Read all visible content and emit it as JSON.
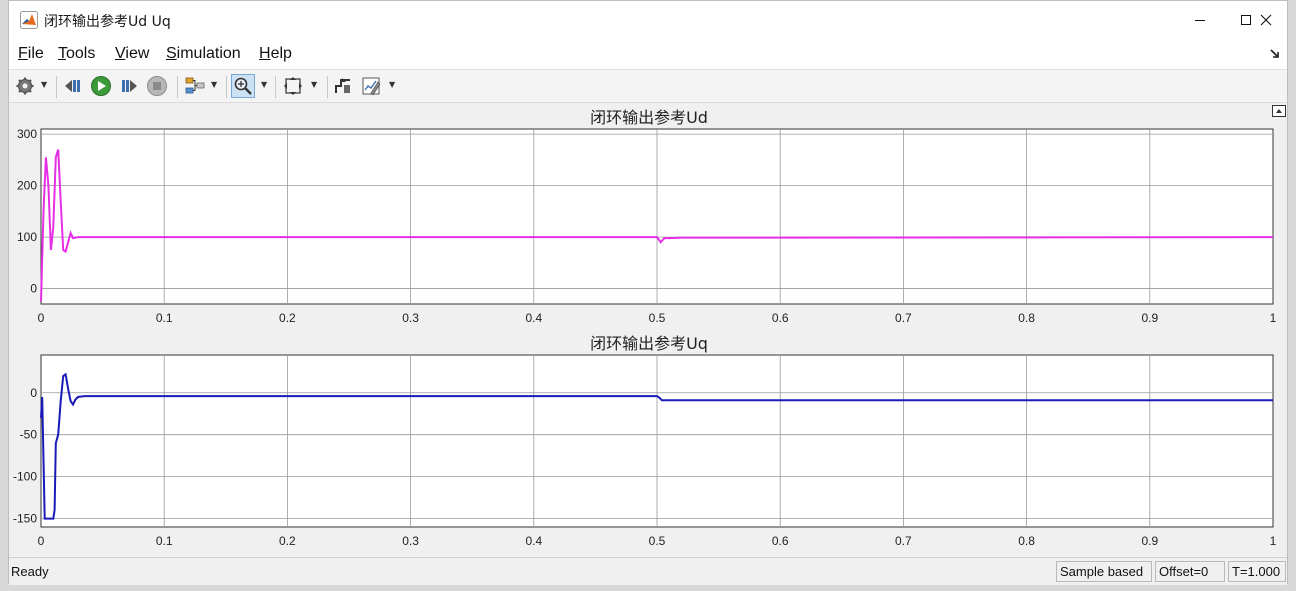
{
  "window": {
    "title": "闭环输出参考Ud Uq"
  },
  "menu": {
    "items": [
      {
        "label": "File",
        "underline": "F",
        "rest": "ile"
      },
      {
        "label": "Tools",
        "underline": "T",
        "rest": "ools"
      },
      {
        "label": "View",
        "underline": "V",
        "rest": "iew"
      },
      {
        "label": "Simulation",
        "underline": "S",
        "rest": "imulation"
      },
      {
        "label": "Help",
        "underline": "H",
        "rest": "elp"
      }
    ]
  },
  "toolbar": {
    "buttons": [
      "gear-icon",
      "step-back-icon",
      "run-icon",
      "step-forward-icon",
      "stop-icon",
      "highlight-icon",
      "zoom-icon",
      "fit-view-icon",
      "triggers-icon",
      "style-icon"
    ]
  },
  "plots": [
    {
      "title": "闭环输出参考Ud",
      "color": "#e62ee6",
      "x_ticks": [
        "0",
        "0.1",
        "0.2",
        "0.3",
        "0.4",
        "0.5",
        "0.6",
        "0.7",
        "0.8",
        "0.9",
        "1"
      ],
      "y_ticks": [
        "300",
        "200",
        "100",
        "0"
      ]
    },
    {
      "title": "闭环输出参考Uq",
      "color": "#1a1ab8",
      "x_ticks": [
        "0",
        "0.1",
        "0.2",
        "0.3",
        "0.4",
        "0.5",
        "0.6",
        "0.7",
        "0.8",
        "0.9",
        "1"
      ],
      "y_ticks": [
        "0",
        "-50",
        "-100",
        "-150"
      ]
    }
  ],
  "chart_data": [
    {
      "type": "line",
      "title": "闭环输出参考Ud",
      "xlim": [
        0,
        1
      ],
      "ylim": [
        -30,
        310
      ],
      "grid": true,
      "series": [
        {
          "color": "#e62ee6",
          "x": [
            0,
            0.002,
            0.004,
            0.006,
            0.008,
            0.01,
            0.012,
            0.014,
            0.016,
            0.018,
            0.02,
            0.022,
            0.024,
            0.026,
            0.03,
            0.035,
            0.05,
            0.5,
            0.503,
            0.506,
            0.51,
            0.52,
            0.6,
            1.0
          ],
          "y": [
            -25,
            150,
            255,
            200,
            75,
            120,
            255,
            270,
            170,
            75,
            72,
            90,
            108,
            98,
            100,
            100,
            100,
            100,
            90,
            98,
            98,
            99,
            99,
            100
          ]
        }
      ]
    },
    {
      "type": "line",
      "title": "闭环输出参考Uq",
      "xlim": [
        0,
        1
      ],
      "ylim": [
        -160,
        45
      ],
      "grid": true,
      "series": [
        {
          "color": "#1a1ab8",
          "x": [
            0,
            0.001,
            0.002,
            0.003,
            0.01,
            0.011,
            0.012,
            0.014,
            0.016,
            0.018,
            0.02,
            0.022,
            0.024,
            0.026,
            0.028,
            0.03,
            0.035,
            0.05,
            0.5,
            0.502,
            0.504,
            0.508,
            0.52,
            0.6,
            1.0
          ],
          "y": [
            -30,
            -5,
            -80,
            -150,
            -150,
            -140,
            -60,
            -50,
            -10,
            20,
            22,
            5,
            -10,
            -14,
            -8,
            -5,
            -4,
            -4,
            -4,
            -6,
            -9,
            -9,
            -9,
            -9,
            -9
          ]
        }
      ]
    }
  ],
  "status": {
    "text": "Ready",
    "sample": "Sample based",
    "offset": "Offset=0",
    "time": "T=1.000"
  }
}
